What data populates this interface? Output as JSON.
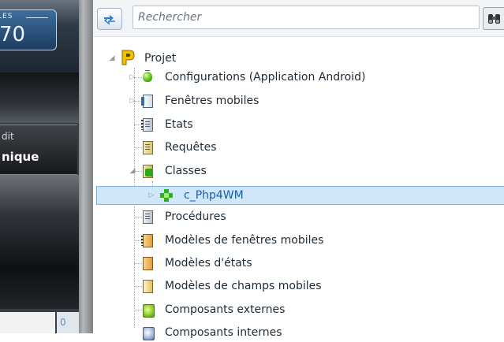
{
  "left_panel": {
    "box_label": "LES",
    "box_number": "70",
    "button_line1": "dit",
    "button_line2": "nique",
    "bottom_text": "0"
  },
  "toolbar": {
    "search_placeholder": "Rechercher",
    "sync_icon": "sync-arrows-icon",
    "find_icon": "binoculars-icon"
  },
  "tree": {
    "root": {
      "label": "Projet",
      "icon": "project-p-icon",
      "expanded": true
    },
    "items": [
      {
        "label": "Configurations (Application Android)",
        "icon": "android-icon",
        "expander": "collapsed"
      },
      {
        "label": "Fenêtres mobiles",
        "icon": "mobile-window-icon",
        "expander": "collapsed"
      },
      {
        "label": "Etats",
        "icon": "report-icon",
        "expander": "none"
      },
      {
        "label": "Requêtes",
        "icon": "query-icon",
        "expander": "none"
      },
      {
        "label": "Classes",
        "icon": "classes-icon",
        "expander": "expanded"
      },
      {
        "label": "c_Php4WM",
        "icon": "class-icon",
        "expander": "collapsed",
        "selected": true
      },
      {
        "label": "Procédures",
        "icon": "procedures-icon",
        "expander": "none"
      },
      {
        "label": "Modèles de fenêtres mobiles",
        "icon": "window-template-icon",
        "expander": "none"
      },
      {
        "label": "Modèles d'états",
        "icon": "report-template-icon",
        "expander": "none"
      },
      {
        "label": "Modèles de champs mobiles",
        "icon": "control-template-icon",
        "expander": "none"
      },
      {
        "label": "Composants externes",
        "icon": "external-component-icon",
        "expander": "none"
      },
      {
        "label": "Composants internes",
        "icon": "internal-component-icon",
        "expander": "none"
      }
    ]
  },
  "colors": {
    "selection_fill": "#cfe6fb",
    "selection_border": "#7fb1e0",
    "selected_text": "#1a5fa8"
  }
}
